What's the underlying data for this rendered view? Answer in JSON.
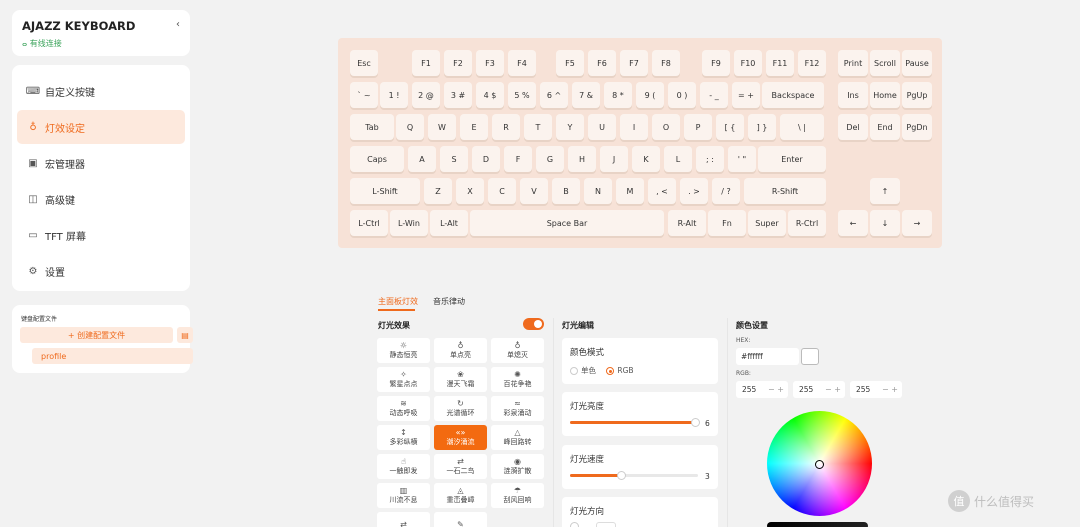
{
  "device": {
    "title": "AJAZZ KEYBOARD",
    "connection": "有线连接",
    "connection_icon": "person-icon",
    "collapse_glyph": "‹"
  },
  "nav": [
    {
      "icon": "keyboard-icon",
      "glyph": "⌨",
      "label": "自定义按键"
    },
    {
      "icon": "bulb-icon",
      "glyph": "♁",
      "label": "灯效设定",
      "active": true
    },
    {
      "icon": "macro-icon",
      "glyph": "▣",
      "label": "宏管理器"
    },
    {
      "icon": "advanced-icon",
      "glyph": "◫",
      "label": "高级键"
    },
    {
      "icon": "monitor-icon",
      "glyph": "▭",
      "label": "TFT 屏幕"
    },
    {
      "icon": "gear-icon",
      "glyph": "⚙",
      "label": "设置"
    }
  ],
  "config": {
    "label": "键盘配置文件",
    "new_label": "+ 创建配置文件",
    "import_icon": "file-import-icon",
    "profile": "profile"
  },
  "keyboard": {
    "rows": [
      [
        "Esc",
        "F1",
        "F2",
        "F3",
        "F4",
        "F5",
        "F6",
        "F7",
        "F8",
        "F9",
        "F10",
        "F11",
        "F12",
        "Print",
        "Scroll",
        "Pause"
      ],
      [
        "` ~",
        "1 !",
        "2 @",
        "3 #",
        "4 $",
        "5 %",
        "6 ^",
        "7 &",
        "8 *",
        "9 (",
        "0 )",
        "- _",
        "= +",
        "Backspace",
        "Ins",
        "Home",
        "PgUp"
      ],
      [
        "Tab",
        "Q",
        "W",
        "E",
        "R",
        "T",
        "Y",
        "U",
        "I",
        "O",
        "P",
        "[ {",
        "] }",
        "\\ |",
        "Del",
        "End",
        "PgDn"
      ],
      [
        "Caps",
        "A",
        "S",
        "D",
        "F",
        "G",
        "H",
        "J",
        "K",
        "L",
        "; :",
        "' \"",
        "Enter"
      ],
      [
        "L-Shift",
        "Z",
        "X",
        "C",
        "V",
        "B",
        "N",
        "M",
        ", <",
        ". >",
        "/ ?",
        "R-Shift",
        "↑"
      ],
      [
        "L-Ctrl",
        "L-Win",
        "L-Alt",
        "Space Bar",
        "R-Alt",
        "Fn",
        "Super",
        "R-Ctrl",
        "←",
        "↓",
        "→"
      ]
    ]
  },
  "tabs": {
    "main": "主面板灯效",
    "music": "音乐律动"
  },
  "effects": {
    "heading": "灯光效果",
    "enabled": true,
    "items": [
      {
        "icon": "sun-icon",
        "glyph": "☼",
        "label": "静态恒亮"
      },
      {
        "icon": "bulb-icon",
        "glyph": "♁",
        "label": "单点亮"
      },
      {
        "icon": "bulb-off-icon",
        "glyph": "♁",
        "label": "单熄灭"
      },
      {
        "icon": "sparkle-icon",
        "glyph": "✧",
        "label": "繁星点点"
      },
      {
        "icon": "flower-icon",
        "glyph": "❀",
        "label": "漫天飞霜"
      },
      {
        "icon": "blossom-icon",
        "glyph": "✺",
        "label": "百花争艳"
      },
      {
        "icon": "breath-icon",
        "glyph": "≋",
        "label": "动态呼吸"
      },
      {
        "icon": "cycle-icon",
        "glyph": "↻",
        "label": "光谱循环"
      },
      {
        "icon": "wave-icon",
        "glyph": "≈",
        "label": "彩泉涌动"
      },
      {
        "icon": "vertical-icon",
        "glyph": "↕",
        "label": "多彩纵横"
      },
      {
        "icon": "ripple-icon",
        "glyph": "«»",
        "label": "潮汐涌流",
        "selected": true
      },
      {
        "icon": "peak-icon",
        "glyph": "△",
        "label": "峰回路转"
      },
      {
        "icon": "touch-icon",
        "glyph": "☝",
        "label": "一触即发"
      },
      {
        "icon": "arrows-icon",
        "glyph": "⇄",
        "label": "一石二鸟"
      },
      {
        "icon": "spread-icon",
        "glyph": "◉",
        "label": "涟漪扩散"
      },
      {
        "icon": "flow-icon",
        "glyph": "▥",
        "label": "川流不息"
      },
      {
        "icon": "stack-icon",
        "glyph": "◬",
        "label": "重峦叠嶂"
      },
      {
        "icon": "storm-icon",
        "glyph": "☂",
        "label": "刮风回响"
      },
      {
        "icon": "swap-icon",
        "glyph": "⇄",
        "label": ""
      },
      {
        "icon": "edit-icon",
        "glyph": "✎",
        "label": ""
      }
    ]
  },
  "editor": {
    "heading": "灯光编辑",
    "color_mode": {
      "label": "颜色模式",
      "options": [
        "单色",
        "RGB"
      ],
      "selected": "RGB"
    },
    "brightness": {
      "label": "灯光亮度",
      "value": "6",
      "fraction": 0.98
    },
    "speed": {
      "label": "灯光速度",
      "value": "3",
      "fraction": 0.4
    },
    "direction": {
      "label": "灯光方向"
    }
  },
  "color": {
    "heading": "颜色设置",
    "hex_label": "HEX:",
    "hex": "#ffffff",
    "rgb_label": "RGB:",
    "rgb": [
      "255",
      "255",
      "255"
    ],
    "step_glyph": "− +",
    "swatch_color": "#ffffff"
  },
  "watermark": {
    "text": "什么值得买",
    "logo": "值"
  }
}
